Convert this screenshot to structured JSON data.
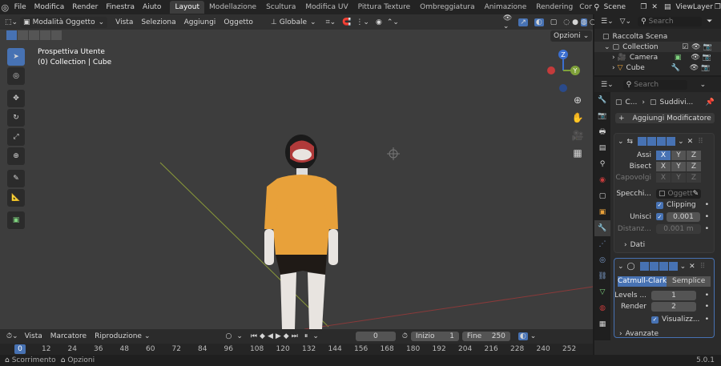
{
  "topmenu": [
    "File",
    "Modifica",
    "Render",
    "Finestra",
    "Aiuto"
  ],
  "workspaces": [
    "Layout",
    "Modellazione",
    "Scultura",
    "Modifica UV",
    "Pittura Texture",
    "Ombreggiatura",
    "Animazione",
    "Rendering",
    "Com"
  ],
  "scene": "Scene",
  "viewlayer": "ViewLayer",
  "header": {
    "mode": "Modalità Oggetto",
    "menus": [
      "Vista",
      "Seleziona",
      "Aggiungi",
      "Oggetto"
    ],
    "orientation": "Globale",
    "options": "Opzioni"
  },
  "viewport": {
    "view_name": "Prospettiva Utente",
    "collection_info": "(0) Collection | Cube",
    "gizmo": {
      "z": "Z",
      "y": "Y"
    }
  },
  "timeline": {
    "menus": [
      "Vista",
      "Marcatore",
      "Riproduzione"
    ],
    "current_frame": "0",
    "start_label": "Inizio",
    "start": "1",
    "end_label": "Fine",
    "end": "250",
    "ticks": [
      "0",
      "12",
      "24",
      "36",
      "48",
      "60",
      "72",
      "84",
      "96",
      "108",
      "120",
      "132",
      "144",
      "156",
      "168",
      "180",
      "192",
      "204",
      "216",
      "228",
      "240",
      "252"
    ]
  },
  "status": {
    "scroll": "Scorrimento",
    "options": "Opzioni",
    "version": "5.0.1"
  },
  "outliner": {
    "search_placeholder": "Search",
    "root": "Raccolta Scena",
    "items": [
      "Collection",
      "Camera",
      "Cube"
    ]
  },
  "properties": {
    "search_placeholder": "Search",
    "breadcrumb_object": "C...",
    "breadcrumb_mod": "Suddivi...",
    "add_modifier": "Aggiungi Modificatore",
    "mirror": {
      "axes_label": "Assi",
      "bisect_label": "Bisect",
      "flip_label": "Capovolgi",
      "axes": [
        "X",
        "Y",
        "Z"
      ],
      "mirror_obj_label": "Specchi...",
      "mirror_obj_placeholder": "Oggett",
      "clipping_label": "Clipping",
      "merge_label": "Unisci",
      "merge_value": "0.001",
      "distance_label": "Distanz...",
      "distance_value": "0.001 m",
      "data_label": "Dati"
    },
    "subsurf": {
      "catmull": "Catmull-Clark",
      "simple": "Semplice",
      "levels_label": "Levels ...",
      "levels_value": "1",
      "render_label": "Render",
      "render_value": "2",
      "visualize_label": "Visualizz...",
      "advanced_label": "Avanzate"
    }
  },
  "colors": {
    "accent": "#4772b3",
    "viewport_bg": "#3d3d3d",
    "shirt": "#e8a13a"
  }
}
